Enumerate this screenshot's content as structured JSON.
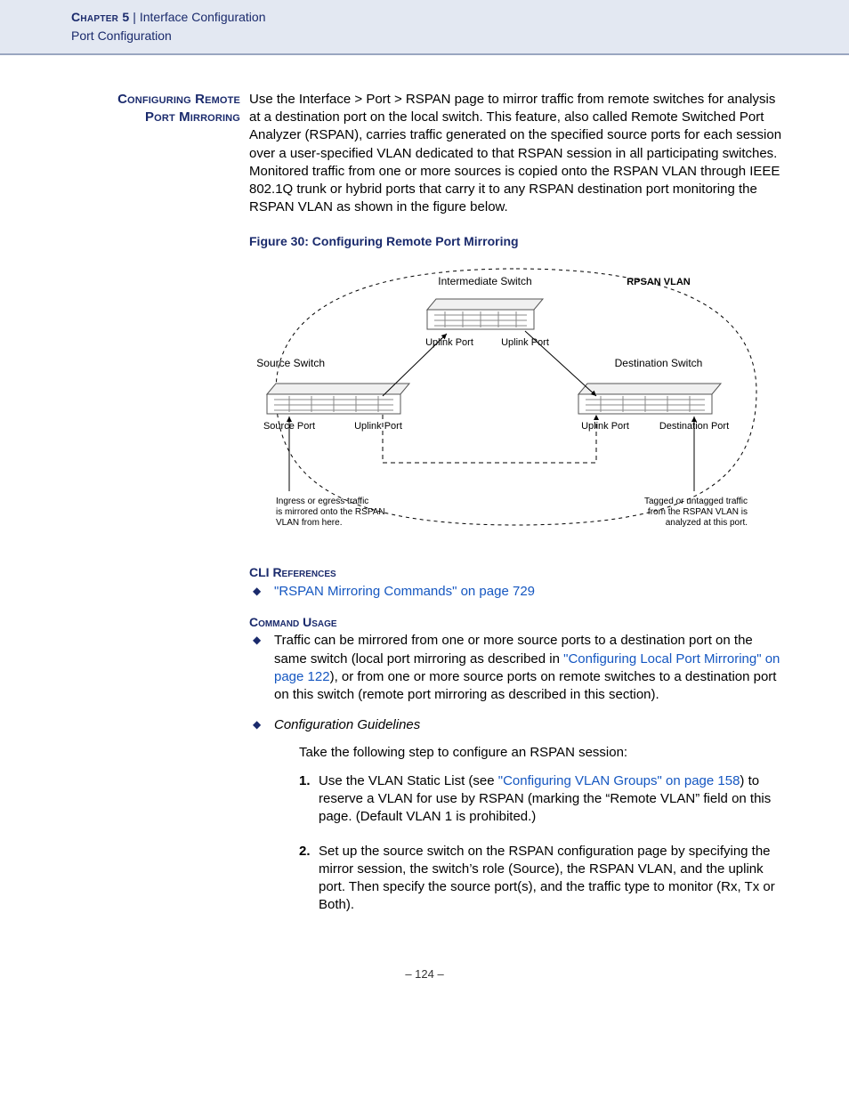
{
  "header": {
    "chapter": "Chapter 5",
    "sep": "  |  ",
    "topic": "Interface Configuration",
    "sub": "Port Configuration"
  },
  "section": {
    "side_title_line1": "Configuring Remote",
    "side_title_line2": "Port Mirroring",
    "intro": "Use the Interface > Port > RSPAN page to mirror traffic from remote switches for analysis at a destination port on the local switch. This feature, also called Remote Switched Port Analyzer (RSPAN), carries traffic generated on the specified source ports for each session over a user-specified VLAN dedicated to that RSPAN session in all participating switches. Monitored traffic from one or more sources is copied onto the RSPAN VLAN through IEEE 802.1Q trunk or hybrid ports that carry it to any RSPAN destination port monitoring the RSPAN VLAN as shown in the figure below."
  },
  "figure": {
    "caption": "Figure 30:  Configuring Remote Port Mirroring",
    "labels": {
      "intermediate": "Intermediate Switch",
      "rpsan_vlan": "RPSAN VLAN",
      "uplink_port": "Uplink Port",
      "source_switch": "Source Switch",
      "destination_switch": "Destination Switch",
      "source_port": "Source Port",
      "destination_port": "Destination Port",
      "note_left": "Ingress or egress traffic is mirrored onto the RSPAN VLAN from here.",
      "note_right": "Tagged or untagged traffic from the RSPAN VLAN is analyzed at this port."
    }
  },
  "cli": {
    "heading": "CLI References",
    "link": "\"RSPAN Mirroring Commands\" on page 729"
  },
  "usage": {
    "heading": "Command Usage",
    "bullet1_a": "Traffic can be mirrored from one or more source ports to a destination port on the same switch (local port mirroring as described in ",
    "bullet1_link": "\"Configuring Local Port Mirroring\" on page 122",
    "bullet1_b": "), or from one or more source ports on remote switches to a destination port on this switch (remote port mirroring as described in this section).",
    "bullet2_title": "Configuration Guidelines",
    "bullet2_intro": "Take the following step to configure an RSPAN session:",
    "steps": {
      "s1_a": "Use the VLAN Static List (see ",
      "s1_link": "\"Configuring VLAN Groups\" on page 158",
      "s1_b": ") to reserve a VLAN for use by RSPAN (marking the “Remote VLAN” field on this page. (Default VLAN 1 is prohibited.)",
      "s2": "Set up the source switch on the RSPAN configuration page by specifying the mirror session, the switch’s role (Source), the RSPAN VLAN, and the uplink port. Then specify the source port(s), and the traffic type to monitor (Rx, Tx or Both)."
    }
  },
  "page_number": "–  124  –"
}
